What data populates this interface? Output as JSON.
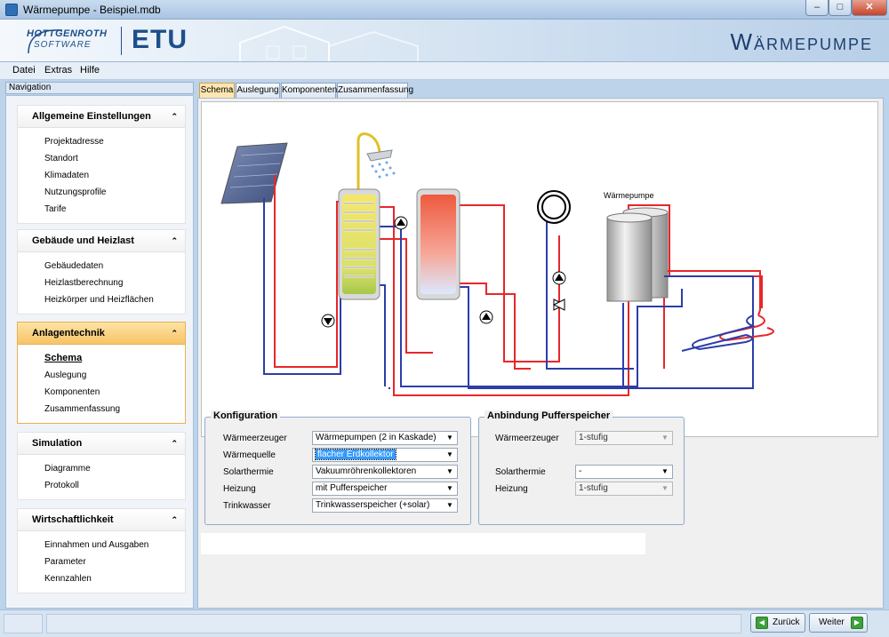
{
  "window": {
    "title": "Wärmepumpe - Beispiel.mdb",
    "min_glyph": "–",
    "max_glyph": "□",
    "close_glyph": "✕"
  },
  "banner": {
    "logo_line1": "HOTTGENROTH",
    "logo_line2": "SOFTWARE",
    "brand": "ETU",
    "product": "Wärmepumpe"
  },
  "menu": {
    "items": [
      {
        "label": "Datei"
      },
      {
        "label": "Extras"
      },
      {
        "label": "Hilfe"
      }
    ]
  },
  "navigation": {
    "header": "Navigation",
    "collapse_glyph": "⌃",
    "groups": [
      {
        "title": "Allgemeine Einstellungen",
        "items": [
          "Projektadresse",
          "Standort",
          "Klimadaten",
          "Nutzungsprofile",
          "Tarife"
        ]
      },
      {
        "title": "Gebäude und Heizlast",
        "items": [
          "Gebäudedaten",
          "Heizlastberechnung",
          "Heizkörper und Heizflächen"
        ]
      },
      {
        "title": "Anlagentechnik",
        "items": [
          "Schema",
          "Auslegung",
          "Komponenten",
          "Zusammenfassung"
        ]
      },
      {
        "title": "Simulation",
        "items": [
          "Diagramme",
          "Protokoll"
        ]
      },
      {
        "title": "Wirtschaftlichkeit",
        "items": [
          "Einnahmen und Ausgaben",
          "Parameter",
          "Kennzahlen"
        ]
      }
    ]
  },
  "tabs": [
    "Schema",
    "Auslegung",
    "Komponenten",
    "Zusammenfassung"
  ],
  "schema": {
    "heatpump_label": "Wärmepumpe"
  },
  "konfiguration": {
    "title": "Konfiguration",
    "rows": [
      {
        "label": "Wärmeerzeuger",
        "value": "Wärmepumpen (2 in Kaskade)"
      },
      {
        "label": "Wärmequelle",
        "value": "flacher Erdkollektor"
      },
      {
        "label": "Solarthermie",
        "value": "Vakuumröhrenkollektoren"
      },
      {
        "label": "Heizung",
        "value": "mit Pufferspeicher"
      },
      {
        "label": "Trinkwasser",
        "value": "Trinkwasserspeicher (+solar)"
      }
    ]
  },
  "anbindung": {
    "title": "Anbindung Pufferspeicher",
    "rows": [
      {
        "label": "Wärmeerzeuger",
        "value": "1-stufig"
      },
      {
        "label": "Solarthermie",
        "value": "-"
      },
      {
        "label": "Heizung",
        "value": "1-stufig"
      }
    ]
  },
  "footer": {
    "back_label": "Zurück",
    "next_label": "Weiter",
    "back_glyph": "◀",
    "next_glyph": "▶"
  },
  "icons": {
    "combo_arrow": "▼"
  },
  "colors": {
    "hot_line": "#e8262a",
    "cold_line": "#2c3ea8",
    "active_nav": "#f7c466",
    "active_tab": "#fde6b0",
    "brand_blue": "#1d4f8a"
  }
}
